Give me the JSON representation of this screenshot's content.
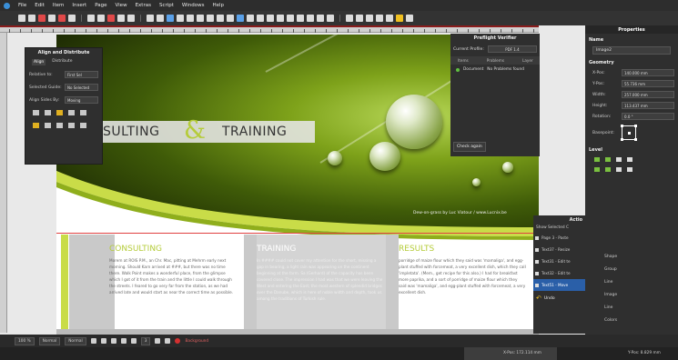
{
  "menubar": [
    "File",
    "Edit",
    "Item",
    "Insert",
    "Page",
    "View",
    "Extras",
    "Script",
    "Windows",
    "Help"
  ],
  "document": {
    "title_left": "SULTING",
    "ampersand": "&",
    "title_right": "TRAINING",
    "photo_credit": "Dew-on-grass by Luc Viatour / www.Lucnix.be",
    "columns": [
      {
        "heading": "CONSULTING",
        "body": "Morem at ROIS P.M., an Chr. Mac, pitting at Mehrm early next morning. Should Karn arrived at ###, but there was no time there. Walk Point makes a wonderful place, from the glimpse which I got of it from the train and the little I could walk through the streets. I feared to go very far from the station, as we had arrived late and would start as near the correct time as possible."
      },
      {
        "heading": "TRAINING",
        "body": "In #### could not cover my attention for the short, missing a gap in bearing, a light rain was appearing on the continent beginning at the farm. Sa (Gerhard) of the capacity has been covered close. The impression I had was that we were leaving the West and entering the East; the most western of splendid bridges over the Danube, which is here of noble width and depth, took us among the traditions of Turkish rule."
      },
      {
        "heading": "RESULTS",
        "body": "porridge of maize flour which they said was 'mamaliga', and egg-plant stuffed with forcemeat, a very excellent dish, which they call 'impletata'. (Mem., get recipe for this also.) I had for breakfast more paprika, and a sort of porridge of maize flour which they said was 'mamaliga', and egg-plant stuffed with forcemeat, a very excellent dish."
      }
    ]
  },
  "align_panel": {
    "title": "Align and Distribute",
    "tabs": [
      "Align",
      "Distribute"
    ],
    "relative_to_label": "Relative to:",
    "relative_to_value": "First Sel",
    "selected_guide_label": "Selected Guide:",
    "selected_guide_value": "No Selected",
    "align_sides_label": "Align Sides By:",
    "align_sides_value": "Moving"
  },
  "preflight": {
    "title": "Preflight Verifier",
    "profile_label": "Current Profile:",
    "profile_value": "PDF 1.4",
    "columns": [
      "Items",
      "Problems",
      "Layer"
    ],
    "result_item": "Document",
    "result_problem": "No Problems found",
    "check_button": "Check again"
  },
  "properties": {
    "title": "Properties",
    "name_section": "Name",
    "name_value": "Image2",
    "geometry_section": "Geometry",
    "fields": [
      {
        "label": "X-Pos:",
        "value": "140.000 mm"
      },
      {
        "label": "Y-Pos:",
        "value": "55.736 mm"
      },
      {
        "label": "Width:",
        "value": "257.000 mm"
      },
      {
        "label": "Height:",
        "value": "113.437 mm"
      },
      {
        "label": "Rotation:",
        "value": "0.0 °"
      }
    ],
    "basepoint_label": "Basepoint:",
    "level_section": "Level",
    "side_list": [
      "Shape",
      "Group",
      "Line",
      "Image",
      "Line",
      "Colors"
    ]
  },
  "actions": {
    "title": "Actio",
    "show_selected": "Show Selected C",
    "items": [
      {
        "label": "Page 3 - Paste",
        "selected": false
      },
      {
        "label": "Text37 - Resize",
        "selected": false
      },
      {
        "label": "Text31 - Edit te",
        "selected": false
      },
      {
        "label": "Text32 - Edit te",
        "selected": false
      },
      {
        "label": "Text51 - Move",
        "selected": true
      }
    ],
    "undo_label": "Undo"
  },
  "statusbar": {
    "zoom": "100 %",
    "preview": "Normal",
    "view_mode": "Normal",
    "page": "3",
    "layer": "Background",
    "rec_label": "Background"
  },
  "bottombar": {
    "coords": "X-Pos: 172.114 mm",
    "ypos": "Y-Pos: 8.829 mm"
  },
  "colors": {
    "accent_green": "#b5cc3a",
    "panel_bg": "#2f2f2f",
    "selection_red": "#e04040"
  }
}
